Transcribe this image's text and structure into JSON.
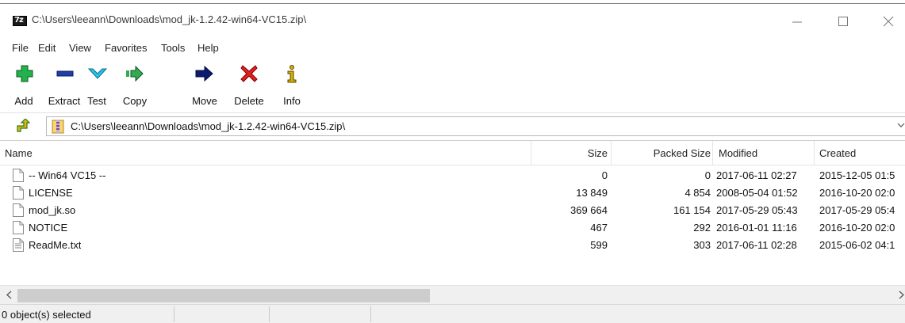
{
  "window": {
    "title": "C:\\Users\\leeann\\Downloads\\mod_jk-1.2.42-win64-VC15.zip\\",
    "app_icon_text": "7z"
  },
  "menu": [
    "File",
    "Edit",
    "View",
    "Favorites",
    "Tools",
    "Help"
  ],
  "toolbar": [
    {
      "label": "Add",
      "icon": "add-icon"
    },
    {
      "label": "Extract",
      "icon": "extract-icon"
    },
    {
      "label": "Test",
      "icon": "test-icon"
    },
    {
      "label": "Copy",
      "icon": "copy-icon"
    },
    {
      "label": "Move",
      "icon": "move-icon"
    },
    {
      "label": "Delete",
      "icon": "delete-icon"
    },
    {
      "label": "Info",
      "icon": "info-icon"
    }
  ],
  "address": {
    "path": "C:\\Users\\leeann\\Downloads\\mod_jk-1.2.42-win64-VC15.zip\\"
  },
  "columns": {
    "name": "Name",
    "size": "Size",
    "packed": "Packed Size",
    "modified": "Modified",
    "created": "Created"
  },
  "files": [
    {
      "name": "-- Win64 VC15 --",
      "size": "0",
      "packed": "0",
      "modified": "2017-06-11 02:27",
      "created": "2015-12-05 01:5",
      "icon": "blank-file-icon"
    },
    {
      "name": "LICENSE",
      "size": "13 849",
      "packed": "4 854",
      "modified": "2008-05-04 01:52",
      "created": "2016-10-20 02:0",
      "icon": "blank-file-icon"
    },
    {
      "name": "mod_jk.so",
      "size": "369 664",
      "packed": "161 154",
      "modified": "2017-05-29 05:43",
      "created": "2017-05-29 05:4",
      "icon": "blank-file-icon"
    },
    {
      "name": "NOTICE",
      "size": "467",
      "packed": "292",
      "modified": "2016-01-01 11:16",
      "created": "2016-10-20 02:0",
      "icon": "blank-file-icon"
    },
    {
      "name": "ReadMe.txt",
      "size": "599",
      "packed": "303",
      "modified": "2017-06-11 02:28",
      "created": "2015-06-02 04:1",
      "icon": "text-file-icon"
    }
  ],
  "status": {
    "selected": "0 object(s) selected"
  },
  "colors": {
    "add": "#22b14c",
    "extract": "#1f3ea8",
    "test": "#27c3e8",
    "copy": "#34a853",
    "move": "#0d1b6e",
    "delete": "#e02020",
    "info": "#d4b000"
  }
}
